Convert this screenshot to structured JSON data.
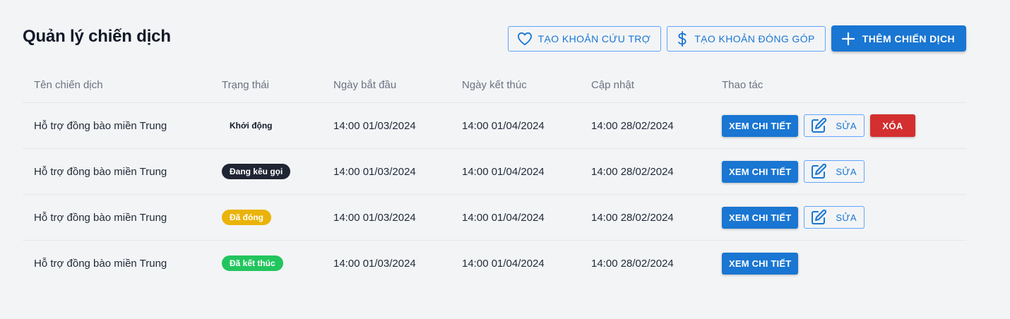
{
  "header": {
    "title": "Quản lý chiến dịch",
    "buttons": {
      "relief": "TẠO KHOẢN CỨU TRỢ",
      "contribution": "TẠO KHOẢN ĐÓNG GÓP",
      "add_campaign": "THÊM CHIẾN DỊCH"
    }
  },
  "colors": {
    "primary": "#1976d2",
    "danger": "#d32f2f",
    "badge_calling": "#1f2533",
    "badge_closed": "#eab308",
    "badge_ended": "#22c55e"
  },
  "table": {
    "columns": [
      "Tên chiến dịch",
      "Trạng thái",
      "Ngày bắt đầu",
      "Ngày kết thúc",
      "Cập nhật",
      "Thao tác"
    ],
    "action_labels": {
      "view": "XEM CHI TIẾT",
      "edit": "SỬA",
      "delete": "XÓA"
    },
    "rows": [
      {
        "name": "Hỗ trợ đồng bào miền Trung",
        "status": "Khởi động",
        "start": "14:00 01/03/2024",
        "end": "14:00 01/04/2024",
        "updated": "14:00 28/02/2024"
      },
      {
        "name": "Hỗ trợ đồng bào miền Trung",
        "status": "Đang kêu gọi",
        "start": "14:00 01/03/2024",
        "end": "14:00 01/04/2024",
        "updated": "14:00 28/02/2024"
      },
      {
        "name": "Hỗ trợ đồng bào miền Trung",
        "status": "Đã đóng",
        "start": "14:00 01/03/2024",
        "end": "14:00 01/04/2024",
        "updated": "14:00 28/02/2024"
      },
      {
        "name": "Hỗ trợ đồng bào miền Trung",
        "status": "Đã kết thúc",
        "start": "14:00 01/03/2024",
        "end": "14:00 01/04/2024",
        "updated": "14:00 28/02/2024"
      }
    ]
  }
}
